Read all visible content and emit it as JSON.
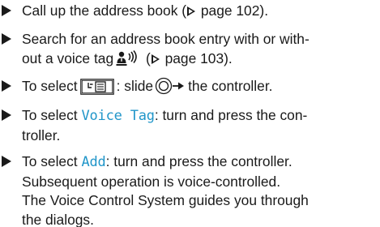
{
  "steps": [
    {
      "prefix": "Call up the address book (",
      "page_ref": "page 102",
      "suffix": ")."
    },
    {
      "line1": "Search for an address book entry with or with-",
      "line2_prefix": "out a voice tag",
      "line2_icon": "voice-tag-icon",
      "line2_page_ref": "page 103",
      "line2_suffix": ")."
    },
    {
      "prefix": "To select",
      "key_icon": "phone-book-menu-key",
      "mid": ": slide",
      "ctrl_icon": "controller-slide-right-icon",
      "suffix": "the controller."
    },
    {
      "prefix": "To select",
      "highlight": "Voice Tag",
      "mid": ": turn and press the con-",
      "line2": "troller."
    },
    {
      "prefix": "To select",
      "highlight": "Add",
      "mid": ": turn and press the controller.",
      "line2": "Subsequent operation is voice-controlled.",
      "line3": "The Voice Control System guides you through",
      "line4": "the dialogs."
    }
  ],
  "colors": {
    "text": "#1a1a1a",
    "highlight": "#2196c9"
  }
}
